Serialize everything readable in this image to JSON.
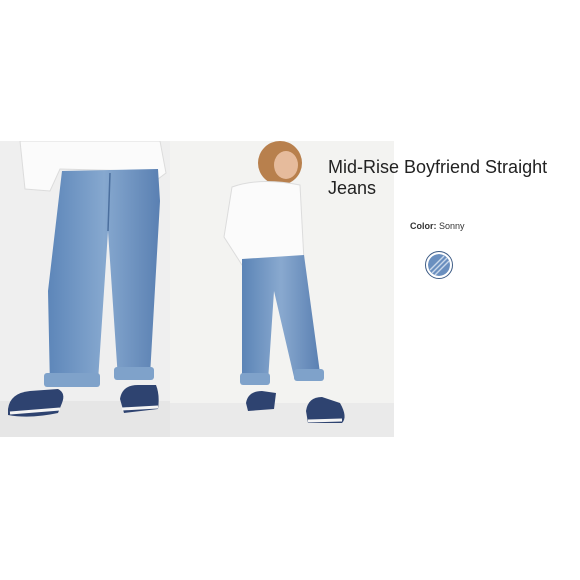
{
  "product": {
    "title": "Mid-Rise Boyfriend Straight Jeans",
    "color_label": "Color:",
    "color_value": "Sonny"
  },
  "images": [
    {
      "name": "front-view-photo",
      "icon": "model-front-jeans"
    },
    {
      "name": "back-view-photo",
      "icon": "model-back-jeans"
    }
  ],
  "swatch": {
    "icon": "denim-swatch-icon",
    "colors": {
      "denim": "#6a8fbf",
      "stripe": "#c9d8ea",
      "border": "#3e5c86"
    }
  }
}
